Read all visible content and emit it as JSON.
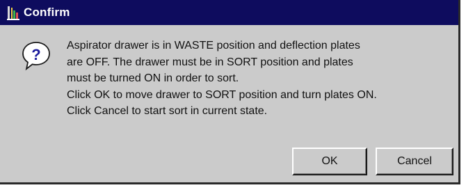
{
  "window": {
    "title": "Confirm",
    "icon": "application-icon"
  },
  "dialog": {
    "icon": "question-icon",
    "message_lines": [
      "Aspirator drawer is in WASTE position and deflection plates",
      "are OFF.  The drawer must be in SORT position and plates",
      "must be turned ON in order to sort.",
      "Click OK to move drawer to SORT position and turn plates ON.",
      "Click Cancel to start sort in current state."
    ]
  },
  "buttons": {
    "ok_label": "OK",
    "cancel_label": "Cancel"
  },
  "colors": {
    "titlebar": "#0e0c5e",
    "dialog_background": "#cbcbcb",
    "question_icon_fill": "#1c1c9c"
  }
}
